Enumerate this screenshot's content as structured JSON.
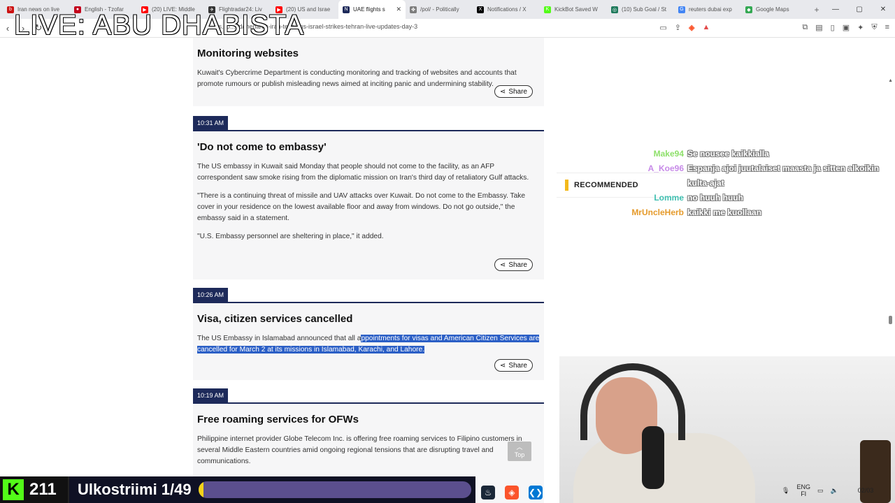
{
  "browser": {
    "tabs": [
      {
        "label": "Iran news on live",
        "fav_color": "#cc1212",
        "fav_glyph": "b"
      },
      {
        "label": "English - Tzofar",
        "fav_color": "#c3001c",
        "fav_glyph": "●"
      },
      {
        "label": "(20) LIVE: Middle",
        "fav_color": "#ff0000",
        "fav_glyph": "▶"
      },
      {
        "label": "Flightradar24: Liv",
        "fav_color": "#333333",
        "fav_glyph": "✈"
      },
      {
        "label": "(20) US and Israe",
        "fav_color": "#ff0000",
        "fav_glyph": "▶"
      },
      {
        "label": "UAE flights s",
        "fav_color": "#1d2a5a",
        "fav_glyph": "N"
      },
      {
        "label": "/pol/ - Politically",
        "fav_color": "#7d7d7d",
        "fav_glyph": "✤"
      },
      {
        "label": "Notifications / X",
        "fav_color": "#000000",
        "fav_glyph": "X"
      },
      {
        "label": "KickBot Saved W",
        "fav_color": "#53fc18",
        "fav_glyph": "K"
      },
      {
        "label": "(10) Sub Goal / St",
        "fav_color": "#1f7a5c",
        "fav_glyph": "◎"
      },
      {
        "label": "reuters dubai exp",
        "fav_color": "#4285f4",
        "fav_glyph": "G"
      },
      {
        "label": "Google Maps",
        "fav_color": "#34a853",
        "fav_glyph": "◆"
      }
    ],
    "active_tab_index": 5,
    "url": "ajazeera.com/news/liveblog/2026/3/2/...rld/mena/us-iran-tensions-israel-strikes-tehran-live-updates-day-3",
    "url_visible": "...es.co...rld/mena/us-iran-tensions-israel-strikes-tehran-live-updates-day-3"
  },
  "stream": {
    "live_title": "LIVE: ABU DHABISTA",
    "kick_count": "211",
    "goal_label": "Ulkostriimi 1/49",
    "goal_progress": 0.02
  },
  "article": {
    "sections": [
      {
        "time": "",
        "title": "Monitoring websites",
        "paragraphs": [
          "Kuwait's Cybercrime Department is conducting monitoring and tracking of websites and accounts that promote rumours or publish misleading news aimed at inciting panic and undermining stability."
        ],
        "share": "Share"
      },
      {
        "time": "10:31 AM",
        "title": "'Do not come to embassy'",
        "paragraphs": [
          "The US embassy in Kuwait said Monday that people should not come to the facility, as an AFP correspondent saw smoke rising from the diplomatic mission on Iran's third day of retaliatory Gulf attacks.",
          "\"There is a continuing threat of missile and UAV attacks over Kuwait. Do not come to the Embassy. Take cover in your residence on the lowest available floor and away from windows. Do not go outside,\" the embassy said in a statement.",
          "\"U.S. Embassy personnel are sheltering in place,\" it added."
        ],
        "share": "Share"
      },
      {
        "time": "10:26 AM",
        "title": "Visa, citizen services cancelled",
        "paragraph_plain": "The US Embassy in Islamabad announced that all a",
        "paragraph_highlight": "ppointments for visas and American Citizen Services are cancelled for March 2 at its missions in Islamabad, Karachi, and Lahore.",
        "share": "Share"
      },
      {
        "time": "10:19 AM",
        "title": "Free roaming services for OFWs",
        "paragraphs": [
          "Philippine internet provider Globe Telecom Inc. is offering free roaming services to Filipino customers in several Middle Eastern countries amid ongoing regional tensions that are disrupting travel and communications."
        ]
      }
    ],
    "recommended": "RECOMMENDED",
    "top_button": "Top"
  },
  "chat": [
    {
      "user": "Make94",
      "color": "#8ee06a",
      "message": "Se nousee kaikkialla"
    },
    {
      "user": "A_Koe96",
      "color": "#c78be8",
      "message": "Espanja ajoi juutalaiset maasta ja sitten alkoikin kulta-ajat"
    },
    {
      "user": "Lomme",
      "color": "#3fbfb0",
      "message": "no huuh huuh"
    },
    {
      "user": "MrUncleHerb",
      "color": "#e59a2a",
      "message": "kaikki me kuollaan"
    }
  ],
  "taskbar": {
    "lang_top": "ENG",
    "lang_bottom": "FI",
    "date": "02/03"
  }
}
